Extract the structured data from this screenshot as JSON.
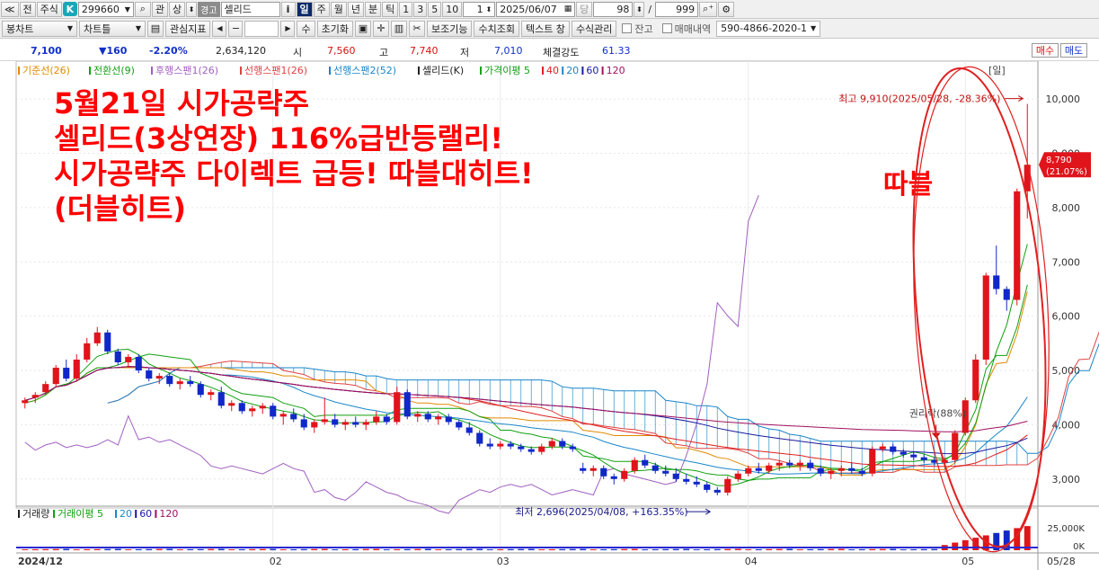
{
  "toolbar1": {
    "prefix_icon": "double-chevron-icon",
    "btn_jeon": "전",
    "btn_stock": "주식",
    "badge": "K",
    "code": "299660",
    "btn_gwan": "관",
    "btn_sang": "상",
    "warn_label": "경고",
    "stock_name": "셀리드",
    "btn_info": "i",
    "periods": [
      "일",
      "주",
      "월",
      "년",
      "분",
      "틱"
    ],
    "intervals": [
      "1",
      "3",
      "5",
      "10"
    ],
    "interval_value": "1",
    "date": "2025/06/07",
    "btn_dang": "당",
    "count": "98",
    "slash": "/",
    "total": "999"
  },
  "toolbar2": {
    "btn_bong": "봉차트",
    "btn_charttool": "차트틀",
    "btn_indicator": "관심지표",
    "btn_su": "수",
    "btn_reset": "초기화",
    "btn_aux": "보조기능",
    "btn_query": "수치조회",
    "btn_text": "텍스트 창",
    "btn_formula": "수식관리",
    "chk_balance": "잔고",
    "chk_trades": "매매내역",
    "account": "590-4866-2020-1"
  },
  "quote": {
    "price": "7,100",
    "change": "▼160",
    "change_pct": "-2.20%",
    "volume": "2,634,120",
    "open_label": "시",
    "open": "7,560",
    "high_label": "고",
    "high": "7,740",
    "low_label": "저",
    "low": "7,010",
    "strength_label": "체결강도",
    "strength": "61.33",
    "buy": "매수",
    "sell": "매도"
  },
  "colors": {
    "up": "#e0141b",
    "down": "#1028c8",
    "cloud": "#1a86c8",
    "annotation": "#ff0000",
    "highlight_ellipse": "#e02020"
  },
  "annotations": {
    "headline": [
      "5월21일 시가공략주",
      "셀리드(3상연장) 116%급반등랠리!",
      "시가공략주 다이렉트 급등! 따블대히트!",
      "(더블히트)"
    ],
    "side_label": "따블",
    "high_marker": "최고 9,910(2025/05/28, -28.36%)",
    "low_marker": "최저 2,696(2025/04/08, +163.35%)",
    "rights_marker": "권리락(88%)"
  },
  "chart_data": {
    "type": "candlestick",
    "title": "",
    "legend": [
      {
        "name": "기준선(26)",
        "color": "#e08a00"
      },
      {
        "name": "전환선(9)",
        "color": "#11a011"
      },
      {
        "name": "후행스팬1(26)",
        "color": "#a060c0"
      },
      {
        "name": "선행스팬1(26)",
        "color": "#e04040"
      },
      {
        "name": "선행스팬2(52)",
        "color": "#1a86c8"
      },
      {
        "name": "셀리드(K)",
        "color": "#222222"
      },
      {
        "name": "가격이평 5",
        "color": "#11a011"
      },
      {
        "name": "40",
        "color": "#e02020"
      },
      {
        "name": "20",
        "color": "#1a86c8"
      },
      {
        "name": "60",
        "color": "#1a1aa0"
      },
      {
        "name": "120",
        "color": "#a01060"
      }
    ],
    "y_ticks": [
      "10,000",
      "9,000",
      "8,000",
      "7,000",
      "6,000",
      "5,000",
      "4,000",
      "3,000"
    ],
    "ylim": [
      2500,
      10400
    ],
    "x_ticks": [
      "2024/12",
      "02",
      "03",
      "04",
      "05",
      "05/28"
    ],
    "current_price": "8,790",
    "current_change": "(21.07%)",
    "volume_legend": [
      {
        "name": "거래량",
        "color": "#222222"
      },
      {
        "name": "거래이평 5",
        "color": "#11a011"
      },
      {
        "name": "20",
        "color": "#1a86c8"
      },
      {
        "name": "60",
        "color": "#1a1aa0"
      },
      {
        "name": "120",
        "color": "#a01060"
      }
    ],
    "volume_ticks": [
      "25,000K",
      "0K"
    ],
    "volume_ylim": [
      0,
      30000
    ],
    "candles": [
      [
        4400,
        4500,
        4300,
        4450
      ],
      [
        4500,
        4600,
        4400,
        4550
      ],
      [
        4600,
        4800,
        4550,
        4750
      ],
      [
        4750,
        5100,
        4700,
        5050
      ],
      [
        5050,
        5200,
        4800,
        4850
      ],
      [
        4850,
        5300,
        4800,
        5200
      ],
      [
        5200,
        5600,
        5150,
        5500
      ],
      [
        5500,
        5800,
        5450,
        5700
      ],
      [
        5700,
        5750,
        5300,
        5350
      ],
      [
        5350,
        5400,
        5100,
        5150
      ],
      [
        5150,
        5300,
        5050,
        5250
      ],
      [
        5250,
        5300,
        4950,
        5000
      ],
      [
        5000,
        5050,
        4800,
        4850
      ],
      [
        4850,
        4950,
        4750,
        4900
      ],
      [
        4900,
        4950,
        4700,
        4750
      ],
      [
        4750,
        4850,
        4650,
        4800
      ],
      [
        4800,
        4900,
        4700,
        4750
      ],
      [
        4750,
        4800,
        4500,
        4550
      ],
      [
        4550,
        4650,
        4450,
        4600
      ],
      [
        4600,
        4700,
        4300,
        4350
      ],
      [
        4350,
        4450,
        4250,
        4400
      ],
      [
        4400,
        4450,
        4200,
        4250
      ],
      [
        4250,
        4350,
        4150,
        4300
      ],
      [
        4300,
        4400,
        4200,
        4350
      ],
      [
        4350,
        4400,
        4100,
        4150
      ],
      [
        4150,
        4250,
        4000,
        4200
      ],
      [
        4200,
        4300,
        4050,
        4100
      ],
      [
        4100,
        4200,
        3900,
        3950
      ],
      [
        3950,
        4100,
        3850,
        4050
      ],
      [
        4050,
        4500,
        4000,
        4100
      ],
      [
        4100,
        4200,
        3950,
        4000
      ],
      [
        4000,
        4100,
        3900,
        4050
      ],
      [
        4050,
        4150,
        3950,
        4000
      ],
      [
        4000,
        4100,
        3900,
        4050
      ],
      [
        4050,
        4250,
        4000,
        4150
      ],
      [
        4150,
        4200,
        4000,
        4050
      ],
      [
        4050,
        4700,
        4000,
        4600
      ],
      [
        4600,
        4650,
        4100,
        4150
      ],
      [
        4150,
        4250,
        4050,
        4200
      ],
      [
        4200,
        4250,
        4050,
        4100
      ],
      [
        4100,
        4200,
        4000,
        4150
      ],
      [
        4150,
        4200,
        4000,
        4050
      ],
      [
        4050,
        4100,
        3900,
        3950
      ],
      [
        3950,
        4050,
        3800,
        3850
      ],
      [
        3850,
        3900,
        3600,
        3650
      ],
      [
        3650,
        3750,
        3550,
        3600
      ],
      [
        3600,
        3700,
        3550,
        3650
      ],
      [
        3650,
        3700,
        3550,
        3600
      ],
      [
        3600,
        3650,
        3500,
        3550
      ],
      [
        3550,
        3600,
        3450,
        3500
      ],
      [
        3500,
        3650,
        3450,
        3600
      ],
      [
        3600,
        3750,
        3550,
        3700
      ],
      [
        3700,
        3750,
        3550,
        3600
      ],
      [
        3600,
        3650,
        3500,
        3550
      ],
      [
        3200,
        3300,
        3100,
        3150
      ],
      [
        3150,
        3250,
        3050,
        3200
      ],
      [
        3200,
        3250,
        3000,
        3050
      ],
      [
        3050,
        3100,
        2900,
        3000
      ],
      [
        3000,
        3200,
        2950,
        3150
      ],
      [
        3150,
        3400,
        3100,
        3350
      ],
      [
        3350,
        3450,
        3200,
        3250
      ],
      [
        3250,
        3300,
        3100,
        3150
      ],
      [
        3150,
        3250,
        3050,
        3100
      ],
      [
        3100,
        3200,
        2950,
        3000
      ],
      [
        3000,
        3100,
        2900,
        2950
      ],
      [
        2950,
        3050,
        2850,
        2900
      ],
      [
        2900,
        2950,
        2750,
        2800
      ],
      [
        2800,
        2850,
        2700,
        2750
      ],
      [
        2750,
        3050,
        2696,
        3000
      ],
      [
        3000,
        3150,
        2950,
        3100
      ],
      [
        3100,
        3250,
        3050,
        3200
      ],
      [
        3200,
        3300,
        3100,
        3150
      ],
      [
        3150,
        3300,
        3100,
        3250
      ],
      [
        3250,
        3350,
        3150,
        3300
      ],
      [
        3300,
        3350,
        3200,
        3250
      ],
      [
        3250,
        3350,
        3150,
        3300
      ],
      [
        3300,
        3350,
        3150,
        3200
      ],
      [
        3200,
        3250,
        3050,
        3100
      ],
      [
        3100,
        3200,
        3000,
        3150
      ],
      [
        3150,
        3250,
        3050,
        3200
      ],
      [
        3200,
        3300,
        3100,
        3150
      ],
      [
        3150,
        3200,
        3050,
        3100
      ],
      [
        3100,
        3600,
        3050,
        3550
      ],
      [
        3550,
        3650,
        3500,
        3600
      ],
      [
        3600,
        3650,
        3450,
        3500
      ],
      [
        3500,
        3550,
        3400,
        3450
      ],
      [
        3450,
        3500,
        3350,
        3400
      ],
      [
        3400,
        3450,
        3300,
        3350
      ],
      [
        3350,
        3400,
        3250,
        3300
      ],
      [
        3300,
        3400,
        3250,
        3350
      ],
      [
        3350,
        3900,
        3300,
        3850
      ],
      [
        3850,
        4500,
        3800,
        4450
      ],
      [
        4450,
        5300,
        4400,
        5200
      ],
      [
        5200,
        6800,
        5100,
        6750
      ],
      [
        6750,
        7300,
        6400,
        6500
      ],
      [
        6500,
        6550,
        6100,
        6300
      ],
      [
        6300,
        8350,
        6200,
        8300
      ],
      [
        8300,
        9910,
        7800,
        8790
      ]
    ]
  }
}
